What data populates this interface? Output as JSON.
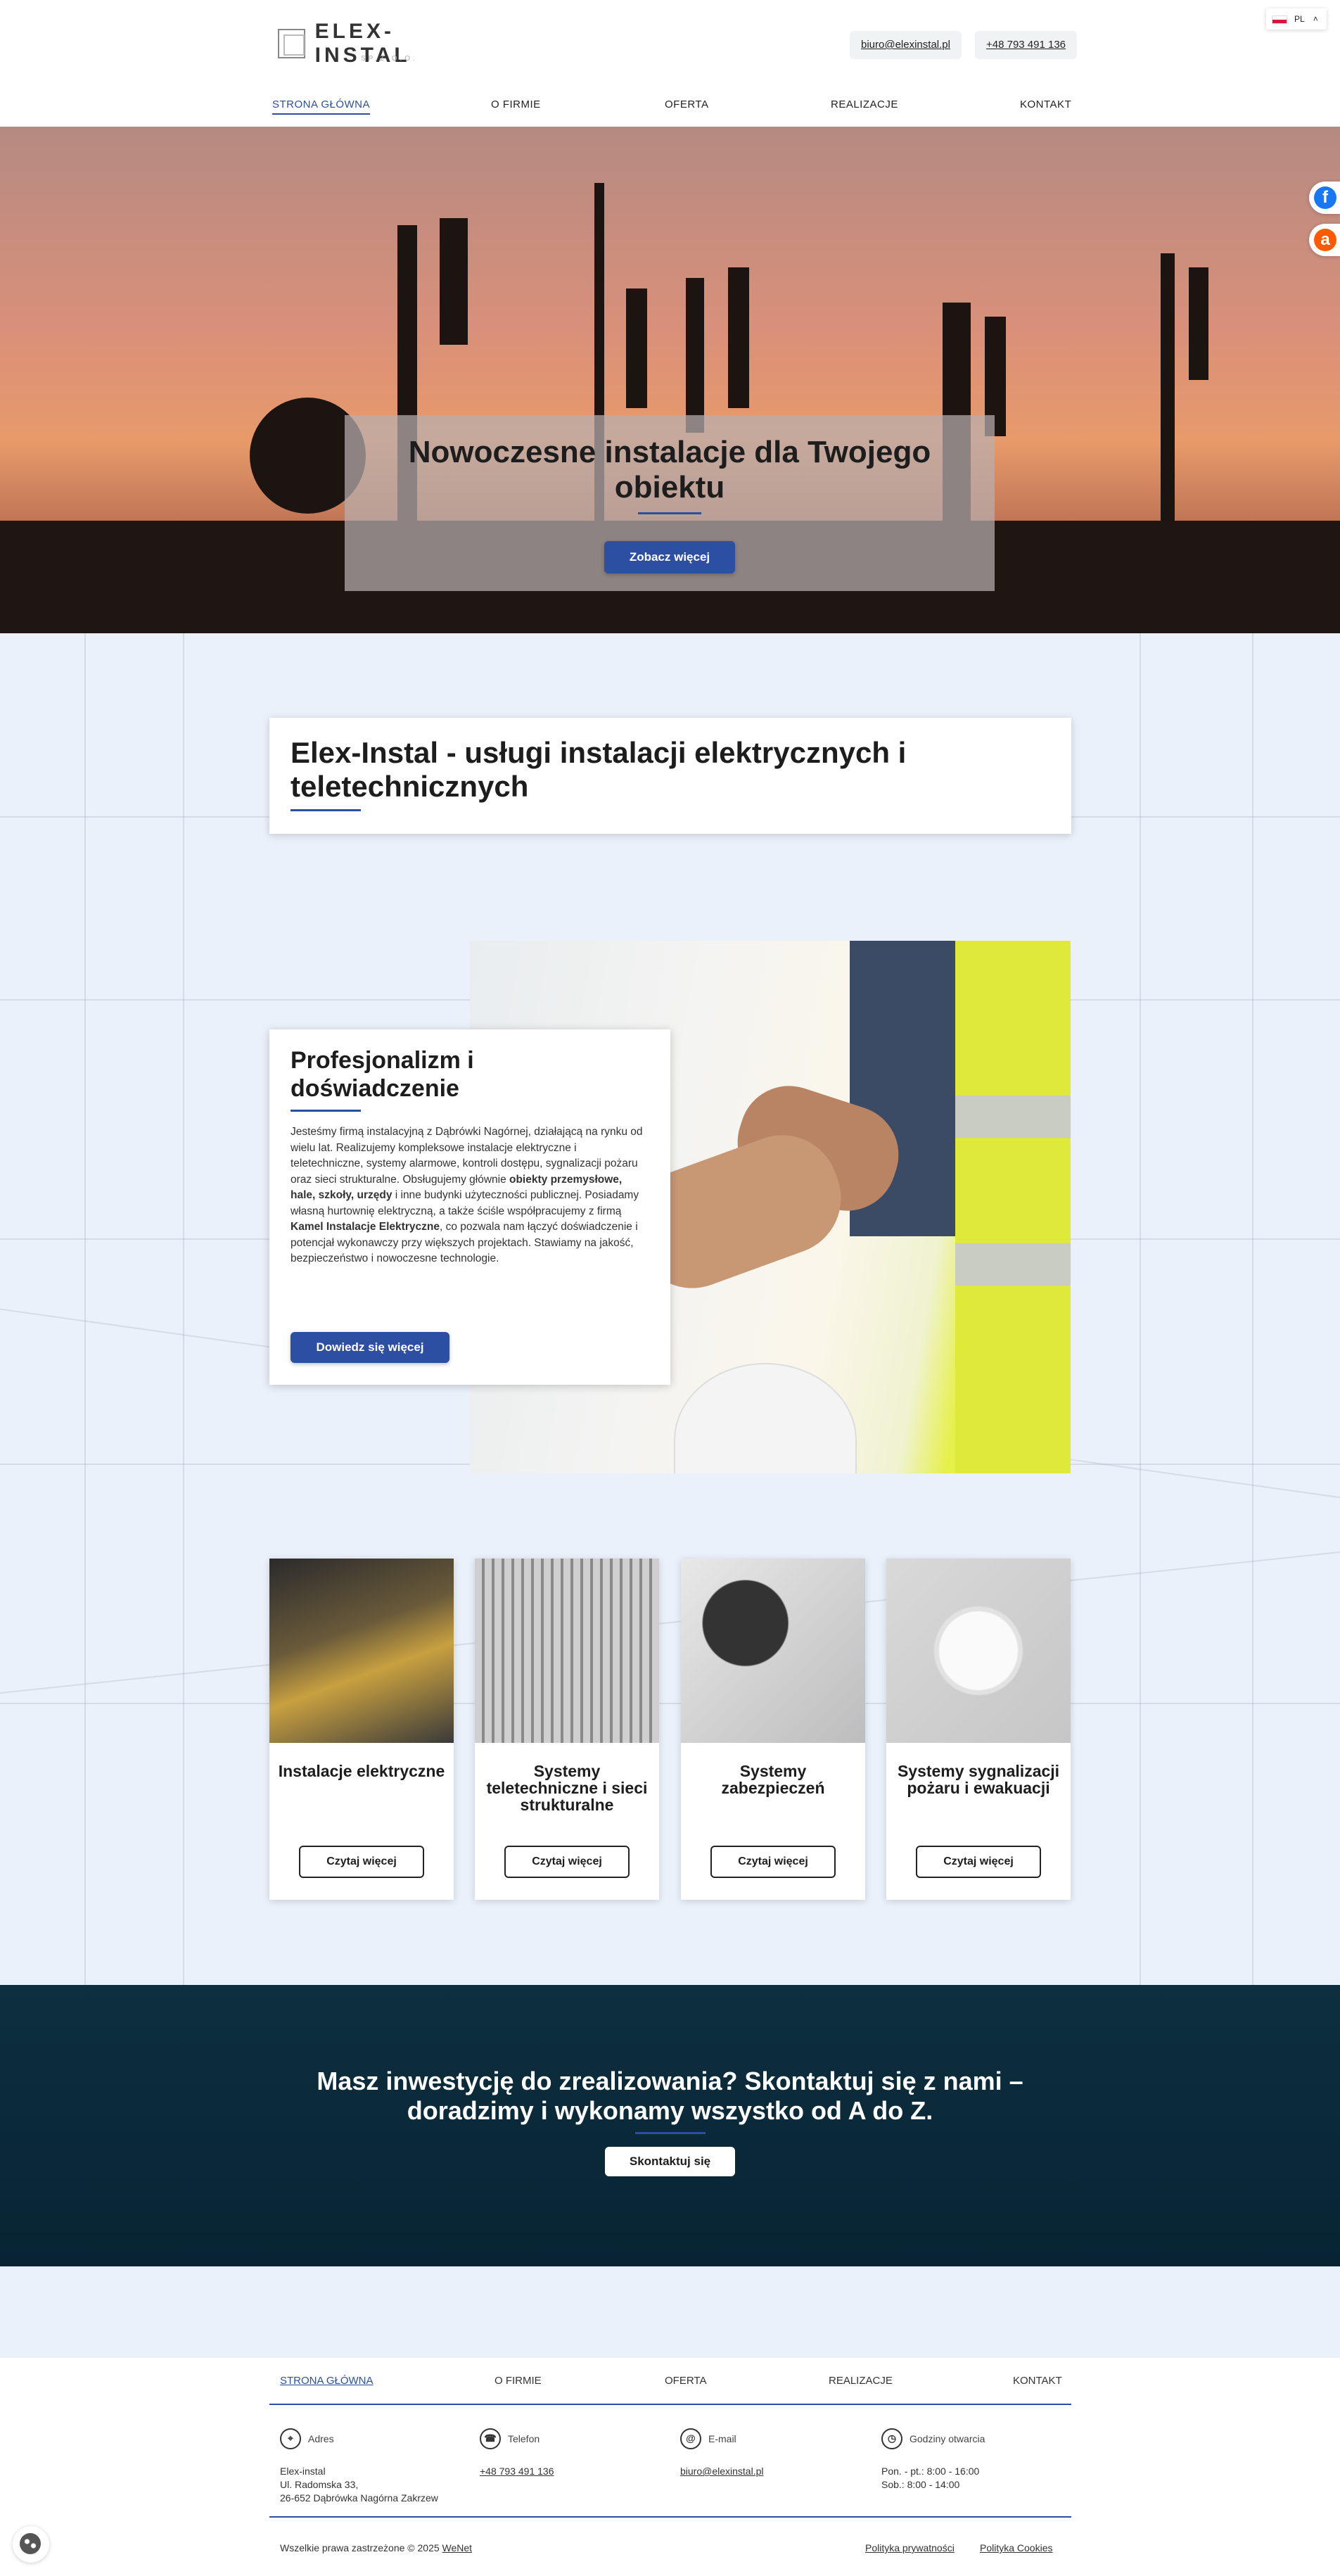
{
  "header": {
    "logo_text": "ELEX-INSTAL",
    "logo_sub": "SP.Z O.O.",
    "email": "biuro@elexinstal.pl",
    "phone": "+48 793 491 136",
    "lang": "PL",
    "nav": [
      "STRONA GŁÓWNA",
      "O FIRMIE",
      "OFERTA",
      "REALIZACJE",
      "KONTAKT"
    ]
  },
  "social": {
    "facebook": "f",
    "allegro": "a"
  },
  "hero": {
    "title": "Nowoczesne instalacje dla Twojego obiektu",
    "button": "Zobacz więcej"
  },
  "intro": {
    "title": "Elex-Instal - usługi instalacji elektrycznych i teletechnicznych"
  },
  "about": {
    "title": "Profesjonalizm i doświadczenie",
    "p1": "Jesteśmy firmą instalacyjną z Dąbrówki Nagórnej, działającą na rynku od wielu lat. Realizujemy kompleksowe instalacje elektryczne i teletechniczne, systemy alarmowe, kontroli dostępu, sygnalizacji pożaru oraz sieci strukturalne. Obsługujemy głównie ",
    "b1": "obiekty przemysłowe, hale, szkoły, urzędy",
    "p2": " i inne budynki użyteczności publicznej. Posiadamy własną hurtownię elektryczną, a także ściśle współpracujemy z firmą ",
    "b2": "Kamel Instalacje Elektryczne",
    "p3": ", co pozwala nam łączyć doświadczenie i potencjał wykonawczy przy większych projektach. Stawiamy na jakość, bezpieczeństwo i nowoczesne technologie.",
    "button": "Dowiedz się więcej"
  },
  "services": [
    {
      "title": "Instalacje elektryczne",
      "button": "Czytaj więcej"
    },
    {
      "title": "Systemy teletechniczne i sieci strukturalne",
      "button": "Czytaj więcej"
    },
    {
      "title": "Systemy zabezpieczeń",
      "button": "Czytaj więcej"
    },
    {
      "title": "Systemy sygnalizacji pożaru i ewakuacji",
      "button": "Czytaj więcej"
    }
  ],
  "cta": {
    "title": "Masz inwestycję do zrealizowania? Skontaktuj się z nami – doradzimy i wykonamy wszystko od A do Z.",
    "button": "Skontaktuj się"
  },
  "footer": {
    "nav": [
      "STRONA GŁÓWNA",
      "O FIRMIE",
      "OFERTA",
      "REALIZACJE",
      "KONTAKT"
    ],
    "address_label": "Adres",
    "address": [
      "Elex-instal",
      "Ul. Radomska 33,",
      "26-652 Dąbrówka Nagórna Zakrzew"
    ],
    "phone_label": "Telefon",
    "phone": "+48 793 491 136",
    "email_label": "E-mail",
    "email": "biuro@elexinstal.pl",
    "hours_label": "Godziny otwarcia",
    "hours": [
      "Pon. - pt.: 8:00 - 16:00",
      "Sob.: 8:00 - 14:00"
    ],
    "copyright": "Wszelkie prawa zastrzeżone © 2025 ",
    "credit": "WeNet",
    "privacy": "Polityka prywatności",
    "cookies": "Polityka Cookies"
  },
  "colors": {
    "accent": "#2c4fa3",
    "cta_bg": "#0d2f3f",
    "blueprint_bg": "#eaf1fb"
  }
}
